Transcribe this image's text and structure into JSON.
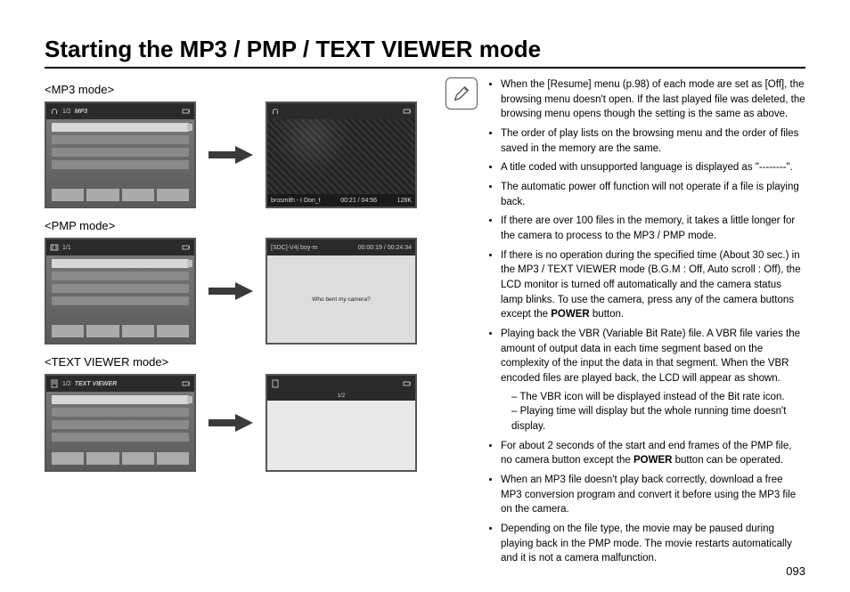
{
  "page": {
    "title": "Starting the MP3 / PMP / TEXT VIEWER mode",
    "number": "093"
  },
  "modes": {
    "mp3": {
      "label": "<MP3 mode>",
      "top_left": "1/2",
      "top_label": "MP3"
    },
    "pmp": {
      "label": "<PMP mode>",
      "top_left": "1/1",
      "player_bar": "[SDC]-V4j  boy-m",
      "player_time": "00:00:19 / 00:24:34",
      "caption": "Who bent my camera?"
    },
    "text": {
      "label": "<TEXT VIEWER mode>",
      "top_left": "1/2",
      "top_label": "TEXT VIEWER",
      "page_indicator": "1/2"
    },
    "video_bar": {
      "title": "brosmith - I Don_t",
      "time": "00:21 / 04:56",
      "rate": "128K"
    }
  },
  "notes": {
    "n1": "When the [Resume] menu (p.98) of each mode are set as [Off], the browsing menu doesn't open. If the last played file was deleted, the browsing menu opens though the setting is the same as above.",
    "n2": "The order of play lists on the browsing menu and the order of files saved in the memory are the same.",
    "n3": "A title coded with unsupported language is displayed as \"--------\".",
    "n4": "The automatic power off function will not operate if a file is playing back.",
    "n5": "If there are over 100 files in the memory, it takes a little longer for the camera to process to the MP3 / PMP mode.",
    "n6a": "If there is no operation during the specified time (About 30 sec.) in the MP3 / TEXT VIEWER mode (B.G.M : Off, Auto scroll : Off), the LCD monitor is turned off automatically and the camera status lamp blinks. To use the camera, press any of the camera buttons except the ",
    "n6b": "POWER",
    "n6c": " button.",
    "n7": "Playing back the VBR (Variable Bit Rate) file. A VBR file varies the amount of output data in each time segment based on the complexity of the input the data in that segment. When the VBR encoded files are played back, the LCD will appear as shown.",
    "n7s1": "The VBR icon will be displayed instead of the Bit rate icon.",
    "n7s2": "Playing time will display but the whole running time doesn't display.",
    "n8a": "For about 2 seconds of the start and end frames of the PMP file, no camera button except the ",
    "n8b": "POWER",
    "n8c": " button can be operated.",
    "n9": "When an MP3 file doesn't play back correctly, download a free MP3 conversion program and convert it before using the MP3 file on the camera.",
    "n10": "Depending on the file type, the movie may be paused during playing back in the PMP mode. The movie restarts automatically and it is not a camera malfunction."
  }
}
